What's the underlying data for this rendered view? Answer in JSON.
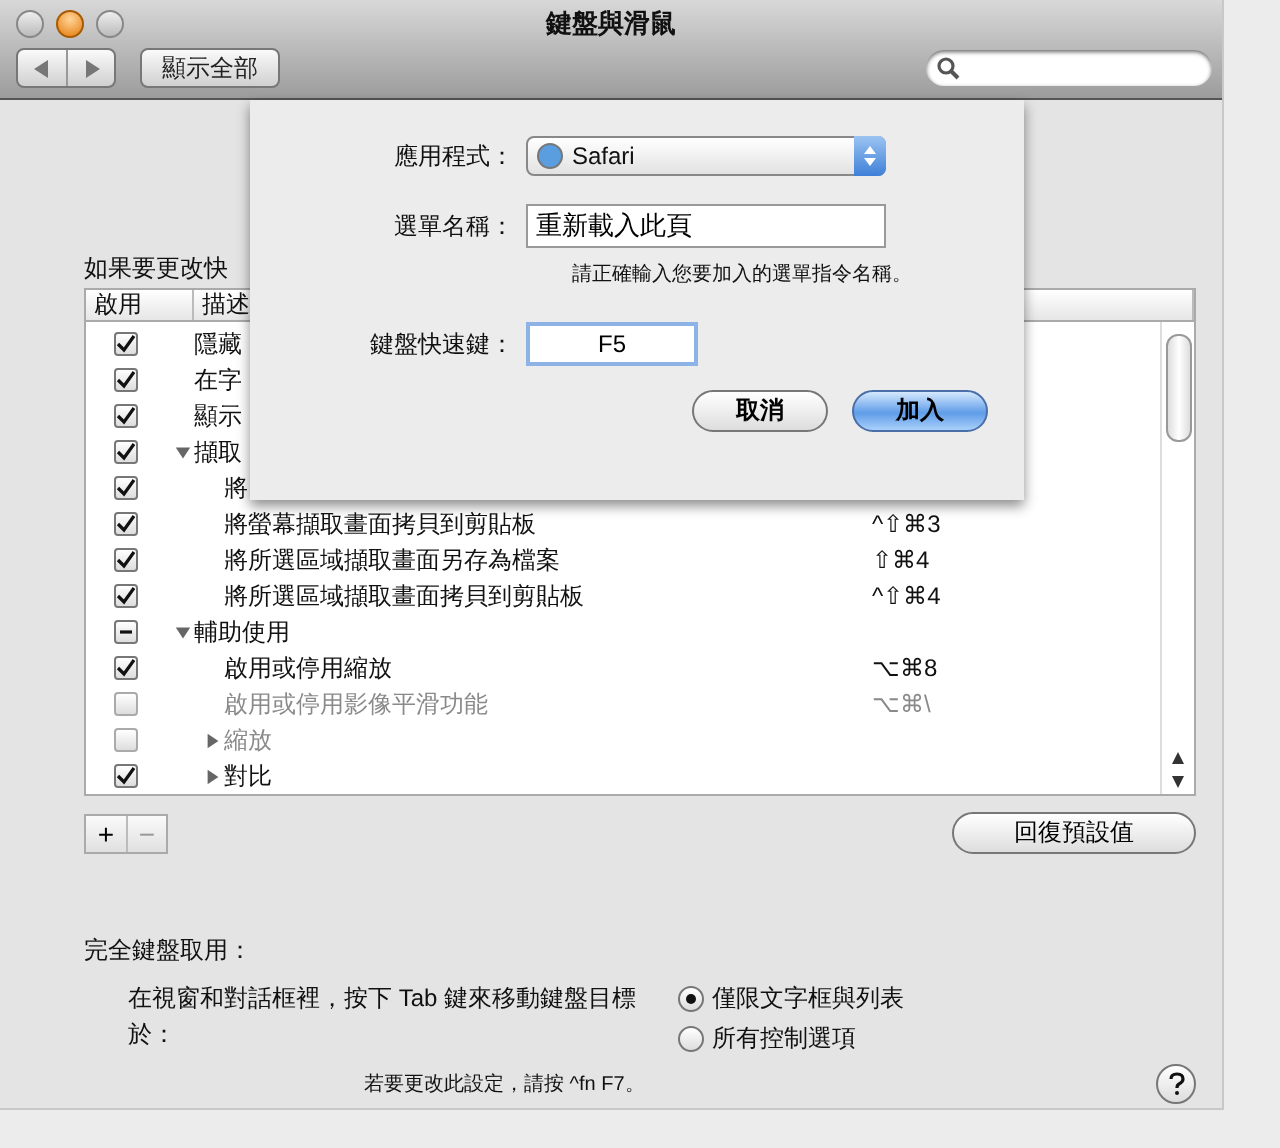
{
  "window": {
    "title": "鍵盤與滑鼠"
  },
  "toolbar": {
    "show_all": "顯示全部"
  },
  "instructions": "如果要更改快",
  "table": {
    "columns": [
      "啟用",
      "描述"
    ],
    "rows": [
      {
        "label": "隱藏",
        "checked": true,
        "mixed": false,
        "disabled": false
      },
      {
        "label": "在字",
        "checked": true,
        "mixed": false,
        "disabled": false
      },
      {
        "label": "顯示",
        "checked": true,
        "mixed": false,
        "disabled": false
      },
      {
        "label": "擷取",
        "checked": true,
        "mixed": false,
        "disabled": false,
        "expanded": true,
        "children": [
          {
            "label": "將",
            "checked": true,
            "mixed": false,
            "disabled": false
          },
          {
            "label": "將螢幕擷取畫面拷貝到剪貼板",
            "shortcut": "^⇧⌘3",
            "checked": true,
            "mixed": false,
            "disabled": false
          },
          {
            "label": "將所選區域擷取畫面另存為檔案",
            "shortcut": "⇧⌘4",
            "checked": true,
            "mixed": false,
            "disabled": false
          },
          {
            "label": "將所選區域擷取畫面拷貝到剪貼板",
            "shortcut": "^⇧⌘4",
            "checked": true,
            "mixed": false,
            "disabled": false
          }
        ]
      },
      {
        "label": "輔助使用",
        "checked": false,
        "mixed": true,
        "disabled": false,
        "expanded": true,
        "children": [
          {
            "label": "啟用或停用縮放",
            "shortcut": "⌥⌘8",
            "checked": true,
            "mixed": false,
            "disabled": false
          },
          {
            "label": "啟用或停用影像平滑功能",
            "shortcut": "⌥⌘\\",
            "checked": false,
            "mixed": false,
            "disabled": true
          },
          {
            "label": "縮放",
            "checked": false,
            "mixed": false,
            "disabled": true,
            "expanded": false
          },
          {
            "label": "對比",
            "checked": true,
            "mixed": false,
            "disabled": false,
            "expanded": false
          }
        ]
      }
    ]
  },
  "list_buttons": [
    "+",
    "−"
  ],
  "restore_button": "回復預設值",
  "full_keyboard_access": {
    "heading": "完全鍵盤取用：",
    "description": "在視窗和對話框裡，按下 Tab 鍵來移動鍵盤目標於：",
    "options": [
      {
        "label": "僅限文字框與列表",
        "selected": true
      },
      {
        "label": "所有控制選項",
        "selected": false
      }
    ],
    "hint": "若要更改此設定，請按 ^fn F7。"
  },
  "sheet": {
    "app_label": "應用程式：",
    "app_value": "Safari",
    "menu_label": "選單名稱：",
    "menu_value": "重新載入此頁",
    "menu_hint": "請正確輸入您要加入的選單指令名稱。",
    "shortcut_label": "鍵盤快速鍵：",
    "shortcut_value": "F5",
    "buttons": [
      {
        "label": "取消",
        "kind": "normal"
      },
      {
        "label": "加入",
        "kind": "default"
      }
    ]
  }
}
